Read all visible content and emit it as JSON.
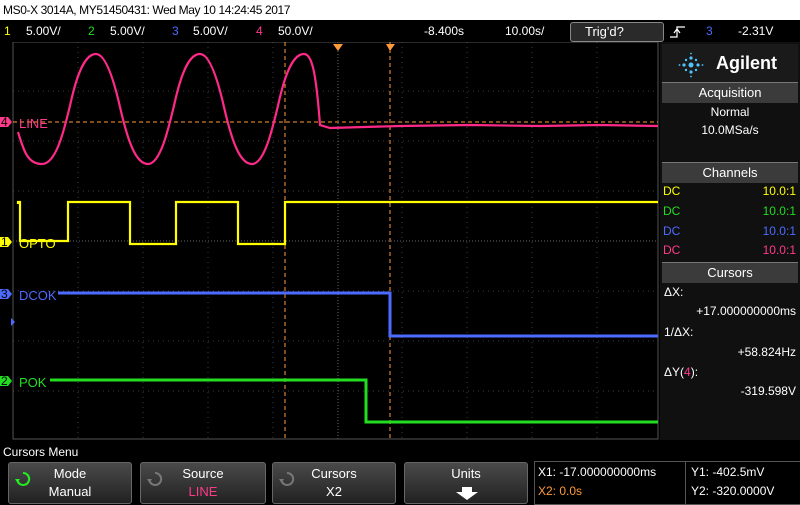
{
  "title_bar": {
    "text": "MS0-X 3014A, MY51450431: Wed May 10 14:24:45 2017"
  },
  "channel_bar": {
    "ch1": {
      "num": "1",
      "scale": "5.00V/",
      "color": "#ffff00"
    },
    "ch2": {
      "num": "2",
      "scale": "5.00V/",
      "color": "#22dd22"
    },
    "ch3": {
      "num": "3",
      "scale": "5.00V/",
      "color": "#4d6bff"
    },
    "ch4": {
      "num": "4",
      "scale": "50.0V/",
      "color": "#ff3a8a"
    },
    "time_offset": "-8.400s",
    "time_scale": "10.00s/",
    "trigger_status": "Trig'd?",
    "trigger_icon": "rising-edge-icon",
    "trigger_source": "3",
    "trigger_level": "-2.31V"
  },
  "traces": {
    "line": {
      "label": "LINE",
      "marker": "4"
    },
    "opto": {
      "label": "OPTO",
      "marker": "1"
    },
    "dcok": {
      "label": "DCOK",
      "marker": "3"
    },
    "pok": {
      "label": "POK",
      "marker": "2"
    }
  },
  "brand": {
    "name": "Agilent",
    "logo": "agilent-spark-icon"
  },
  "acquisition": {
    "header": "Acquisition",
    "mode": "Normal",
    "rate": "10.0MSa/s"
  },
  "channels": {
    "header": "Channels",
    "rows": [
      {
        "coupling": "DC",
        "probe": "10.0:1",
        "color": "#ffff00"
      },
      {
        "coupling": "DC",
        "probe": "10.0:1",
        "color": "#22dd22"
      },
      {
        "coupling": "DC",
        "probe": "10.0:1",
        "color": "#4d6bff"
      },
      {
        "coupling": "DC",
        "probe": "10.0:1",
        "color": "#ff3a8a"
      }
    ]
  },
  "cursors_panel": {
    "header": "Cursors",
    "dx_label": "ΔX:",
    "dx_value": "+17.000000000ms",
    "inv_dx_label": "1/ΔX:",
    "inv_dx_value": "+58.824Hz",
    "dy_label_pre": "ΔY(",
    "dy_channel": "4",
    "dy_label_post": "):",
    "dy_value": "-319.598V"
  },
  "menu": {
    "title": "Cursors Menu"
  },
  "softkeys": [
    {
      "label": "Mode",
      "value": "Manual",
      "icon": "rotate-knob-icon"
    },
    {
      "label": "Source",
      "value": "LINE",
      "icon": "rotate-knob-icon"
    },
    {
      "label": "Cursors",
      "value": "X2",
      "icon": "rotate-knob-icon"
    },
    {
      "label": "Units",
      "value": "",
      "icon": "down-arrow-icon"
    }
  ],
  "cursor_readout": {
    "x1": "X1: -17.000000000ms",
    "x2": "X2: 0.0s",
    "y1": "Y1: -402.5mV",
    "y2": "Y2: -320.0000V"
  }
}
